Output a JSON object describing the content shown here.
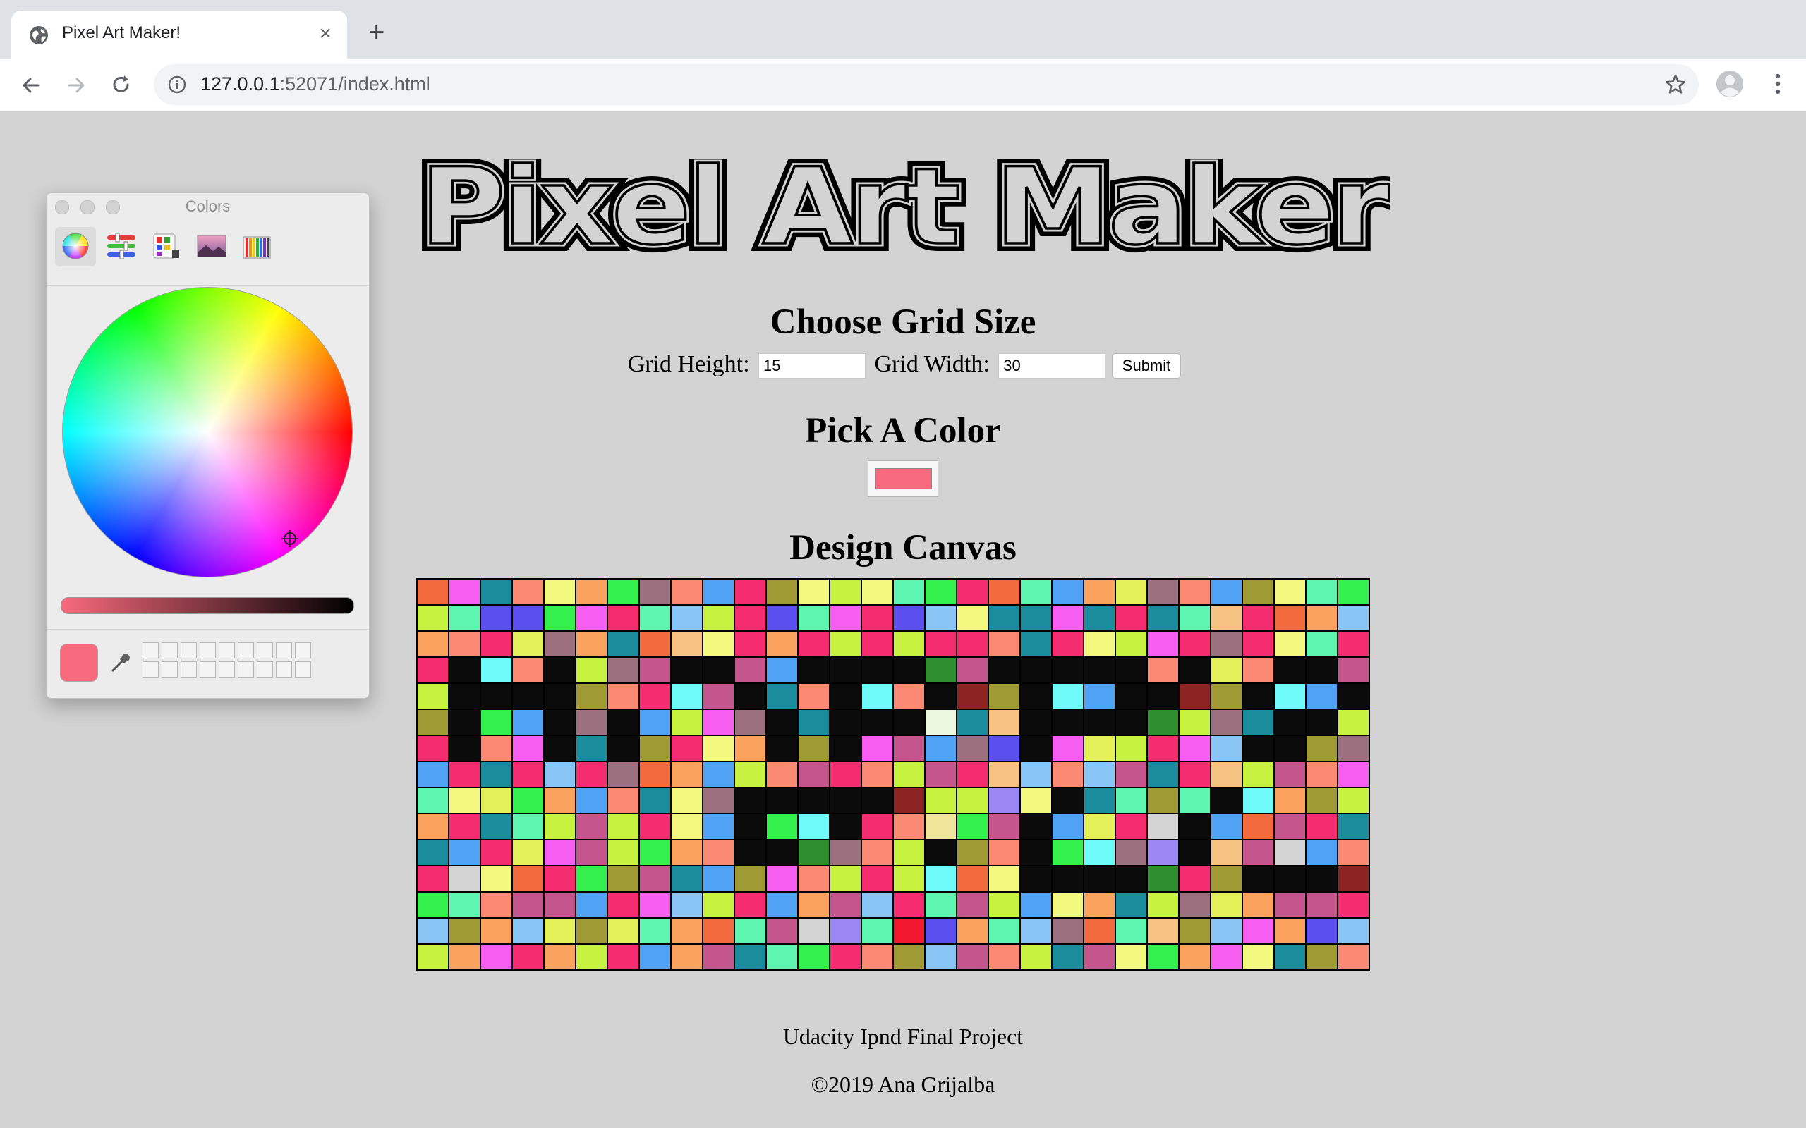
{
  "browser": {
    "tab_title": "Pixel Art Maker!",
    "url_host": "127.0.0.1",
    "url_rest": ":52071/index.html"
  },
  "page": {
    "title": "Pixel Art Maker",
    "grid_heading": "Choose Grid Size",
    "grid_height_label": "Grid Height:",
    "grid_height_value": "15",
    "grid_width_label": "Grid Width:",
    "grid_width_value": "30",
    "submit_label": "Submit",
    "color_heading": "Pick A Color",
    "selected_color": "#f86a7d",
    "canvas_heading": "Design Canvas",
    "footer_line1": "Udacity Ipnd Final Project",
    "footer_line2": "©2019 Ana Grijalba"
  },
  "colors_panel": {
    "title": "Colors",
    "current_color": "#f86a7d",
    "tabs": [
      "color-wheel",
      "color-sliders",
      "color-palettes",
      "image-palettes",
      "pencils"
    ]
  },
  "palette": {
    "O": "#f26a3d",
    "P": "#f55ef0",
    "T": "#1a8c9c",
    "S": "#fb8a75",
    "Y": "#f3f97f",
    "N": "#fba35e",
    "G": "#33f04d",
    "M": "#9c707e",
    "B": "#4fa2f4",
    "R": "#f52d70",
    "L": "#c7f23f",
    "Q": "#5df5b0",
    "V": "#5b50ef",
    "K": "#8ac6f5",
    "A": "#a09a34",
    "H": "#c5568d",
    "C": "#70fbfb",
    "D": "#2f8e2e",
    "E": "#8c2424",
    "F": "#edf8e0",
    "U": "#f0e59b",
    "W": "#d4d4d4",
    "I": "#9b88f5",
    "Z": "#f2182d",
    "X": "#f6c383",
    "J": "#e4f058",
    "_": "#0b0b0b"
  },
  "canvas_rows": [
    "OPTSYNGMSBRAYLYQGROQBNJMSBAYQG",
    "LQVVGPRQKLRVQPRVKYTTPTRTQXRONK",
    "NSRJMNTOXYRNRLRLRRSTRYLPRMRYQR",
    "R_CS_LMH__HB____DH_____S_JS__H",
    "L____ASRCH_TS_CS_EA_CB__EA_CB_T",
    "A_GB_M_BLPM_T___FTX____DLMT__LK",
    "R_SP_T_ARYN_A_PHBMV_PJLRPK__AM",
    "BRTRKRMONBLSHRSLHRXKSKHTRXLHSP",
    "QYJGNBSTYM_____ELLIY_TQAQ_CNALN",
    "NRTQLHLRYB_GC_RSUGH_BJRW_BOHRT",
    "TBRJPHLGNS__DMSL_AS_GCMI_XHWBS",
    "RWYORGAHTBAPSLRLCOY____DRA___EA",
    "GQSHHBRPKLRBNHKRQHLBYNTLMJNHHR",
    "KANKJAJQNOQHWIQZVNQKMOQXAKPNVK",
    "LNPRNLRBNHTQGRSAKHSLTHYGNPYTAS"
  ]
}
